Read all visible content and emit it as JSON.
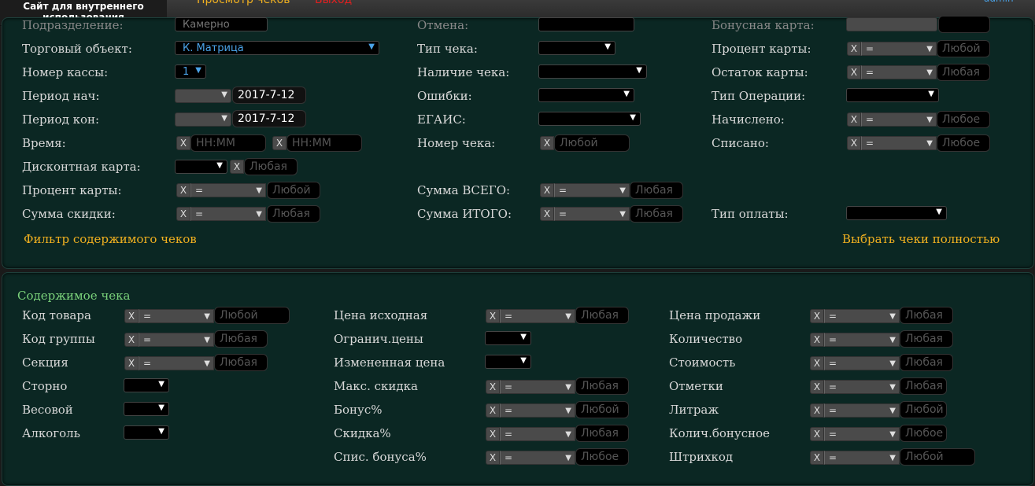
{
  "header": {
    "logo_text": "Сайт для внутреннего использования",
    "nav_reports": "Просмотр чеков",
    "nav_logout": "Выход",
    "user": "admin"
  },
  "filters": {
    "row0": {
      "podr": "Подразделение:",
      "podr_val": "Камерно",
      "otmena": "Отмена:",
      "bonus_card": "Бонусная карта:"
    },
    "trade_object": {
      "label": "Торговый объект:",
      "value": "К. Матрица"
    },
    "kassa": {
      "label": "Номер кассы:",
      "value": "1"
    },
    "period_start": {
      "label": "Период нач:",
      "date": "2017-7-12"
    },
    "period_end": {
      "label": "Период кон:",
      "date": "2017-7-12"
    },
    "time": {
      "label": "Время:",
      "from_placeholder": "HH:MM",
      "to_placeholder": "HH:MM"
    },
    "discount_card": {
      "label": "Дисконтная карта:",
      "placeholder": "Любая"
    },
    "card_percent_left": {
      "label": "Процент карты:",
      "op": "=",
      "placeholder": "Любой"
    },
    "discount_sum": {
      "label": "Сумма скидки:",
      "op": "=",
      "placeholder": "Любая"
    },
    "check_type": {
      "label": "Тип чека:"
    },
    "check_presence": {
      "label": "Наличие чека:"
    },
    "errors": {
      "label": "Ошибки:"
    },
    "egais": {
      "label": "ЕГАИС:"
    },
    "check_number": {
      "label": "Номер чека:",
      "placeholder": "Любой"
    },
    "sum_total": {
      "label": "Сумма ВСЕГО:",
      "op": "=",
      "placeholder": "Любая"
    },
    "sum_itogo": {
      "label": "Сумма ИТОГО:",
      "op": "=",
      "placeholder": "Любая"
    },
    "card_percent_right": {
      "label": "Процент карты:",
      "op": "=",
      "placeholder": "Любой"
    },
    "card_balance": {
      "label": "Остаток карты:",
      "op": "=",
      "placeholder": "Любая"
    },
    "operation_type": {
      "label": "Тип Операции:"
    },
    "accrued": {
      "label": "Начислено:",
      "op": "=",
      "placeholder": "Любое"
    },
    "written_off": {
      "label": "Списано:",
      "op": "=",
      "placeholder": "Любое"
    },
    "payment_type": {
      "label": "Тип оплаты:"
    },
    "link_filter": "Фильтр содержимого чеков",
    "link_select_full": "Выбрать чеки полностью"
  },
  "contents": {
    "title": "Содержимое чека",
    "product_code": {
      "label": "Код товара",
      "op": "=",
      "placeholder": "Любой"
    },
    "group_code": {
      "label": "Код группы",
      "op": "=",
      "placeholder": "Любая"
    },
    "section": {
      "label": "Секция",
      "op": "=",
      "placeholder": "Любая"
    },
    "storno": {
      "label": "Сторно"
    },
    "weight": {
      "label": "Весовой"
    },
    "alcohol": {
      "label": "Алкоголь"
    },
    "orig_price": {
      "label": "Цена исходная",
      "op": "=",
      "placeholder": "Любая"
    },
    "price_limit": {
      "label": "Огранич.цены"
    },
    "changed_price": {
      "label": "Измененная цена"
    },
    "max_discount": {
      "label": "Макс. скидка",
      "op": "=",
      "placeholder": "Любая"
    },
    "bonus_pct": {
      "label": "Бонус%",
      "op": "=",
      "placeholder": "Любой"
    },
    "discount_pct": {
      "label": "Скидка%",
      "op": "=",
      "placeholder": "Любая"
    },
    "bonus_writeoff_pct": {
      "label": "Спис. бонуса%",
      "op": "=",
      "placeholder": "Любое"
    },
    "sale_price": {
      "label": "Цена продажи",
      "op": "=",
      "placeholder": "Любая"
    },
    "quantity": {
      "label": "Количество",
      "op": "=",
      "placeholder": "Любая"
    },
    "cost": {
      "label": "Стоимость",
      "op": "=",
      "placeholder": "Любая"
    },
    "marks": {
      "label": "Отметки",
      "op": "=",
      "placeholder": "Любая"
    },
    "liters": {
      "label": "Литраж",
      "op": "=",
      "placeholder": "Любой"
    },
    "bonus_qty": {
      "label": "Колич.бонусное",
      "op": "=",
      "placeholder": "Любое"
    },
    "barcode": {
      "label": "Штрихкод",
      "op": "=",
      "placeholder": "Любой"
    }
  },
  "colors": {
    "accent_link": "#f0b020",
    "section_title": "#7bd37b",
    "panel_bg": "#0b2723"
  }
}
